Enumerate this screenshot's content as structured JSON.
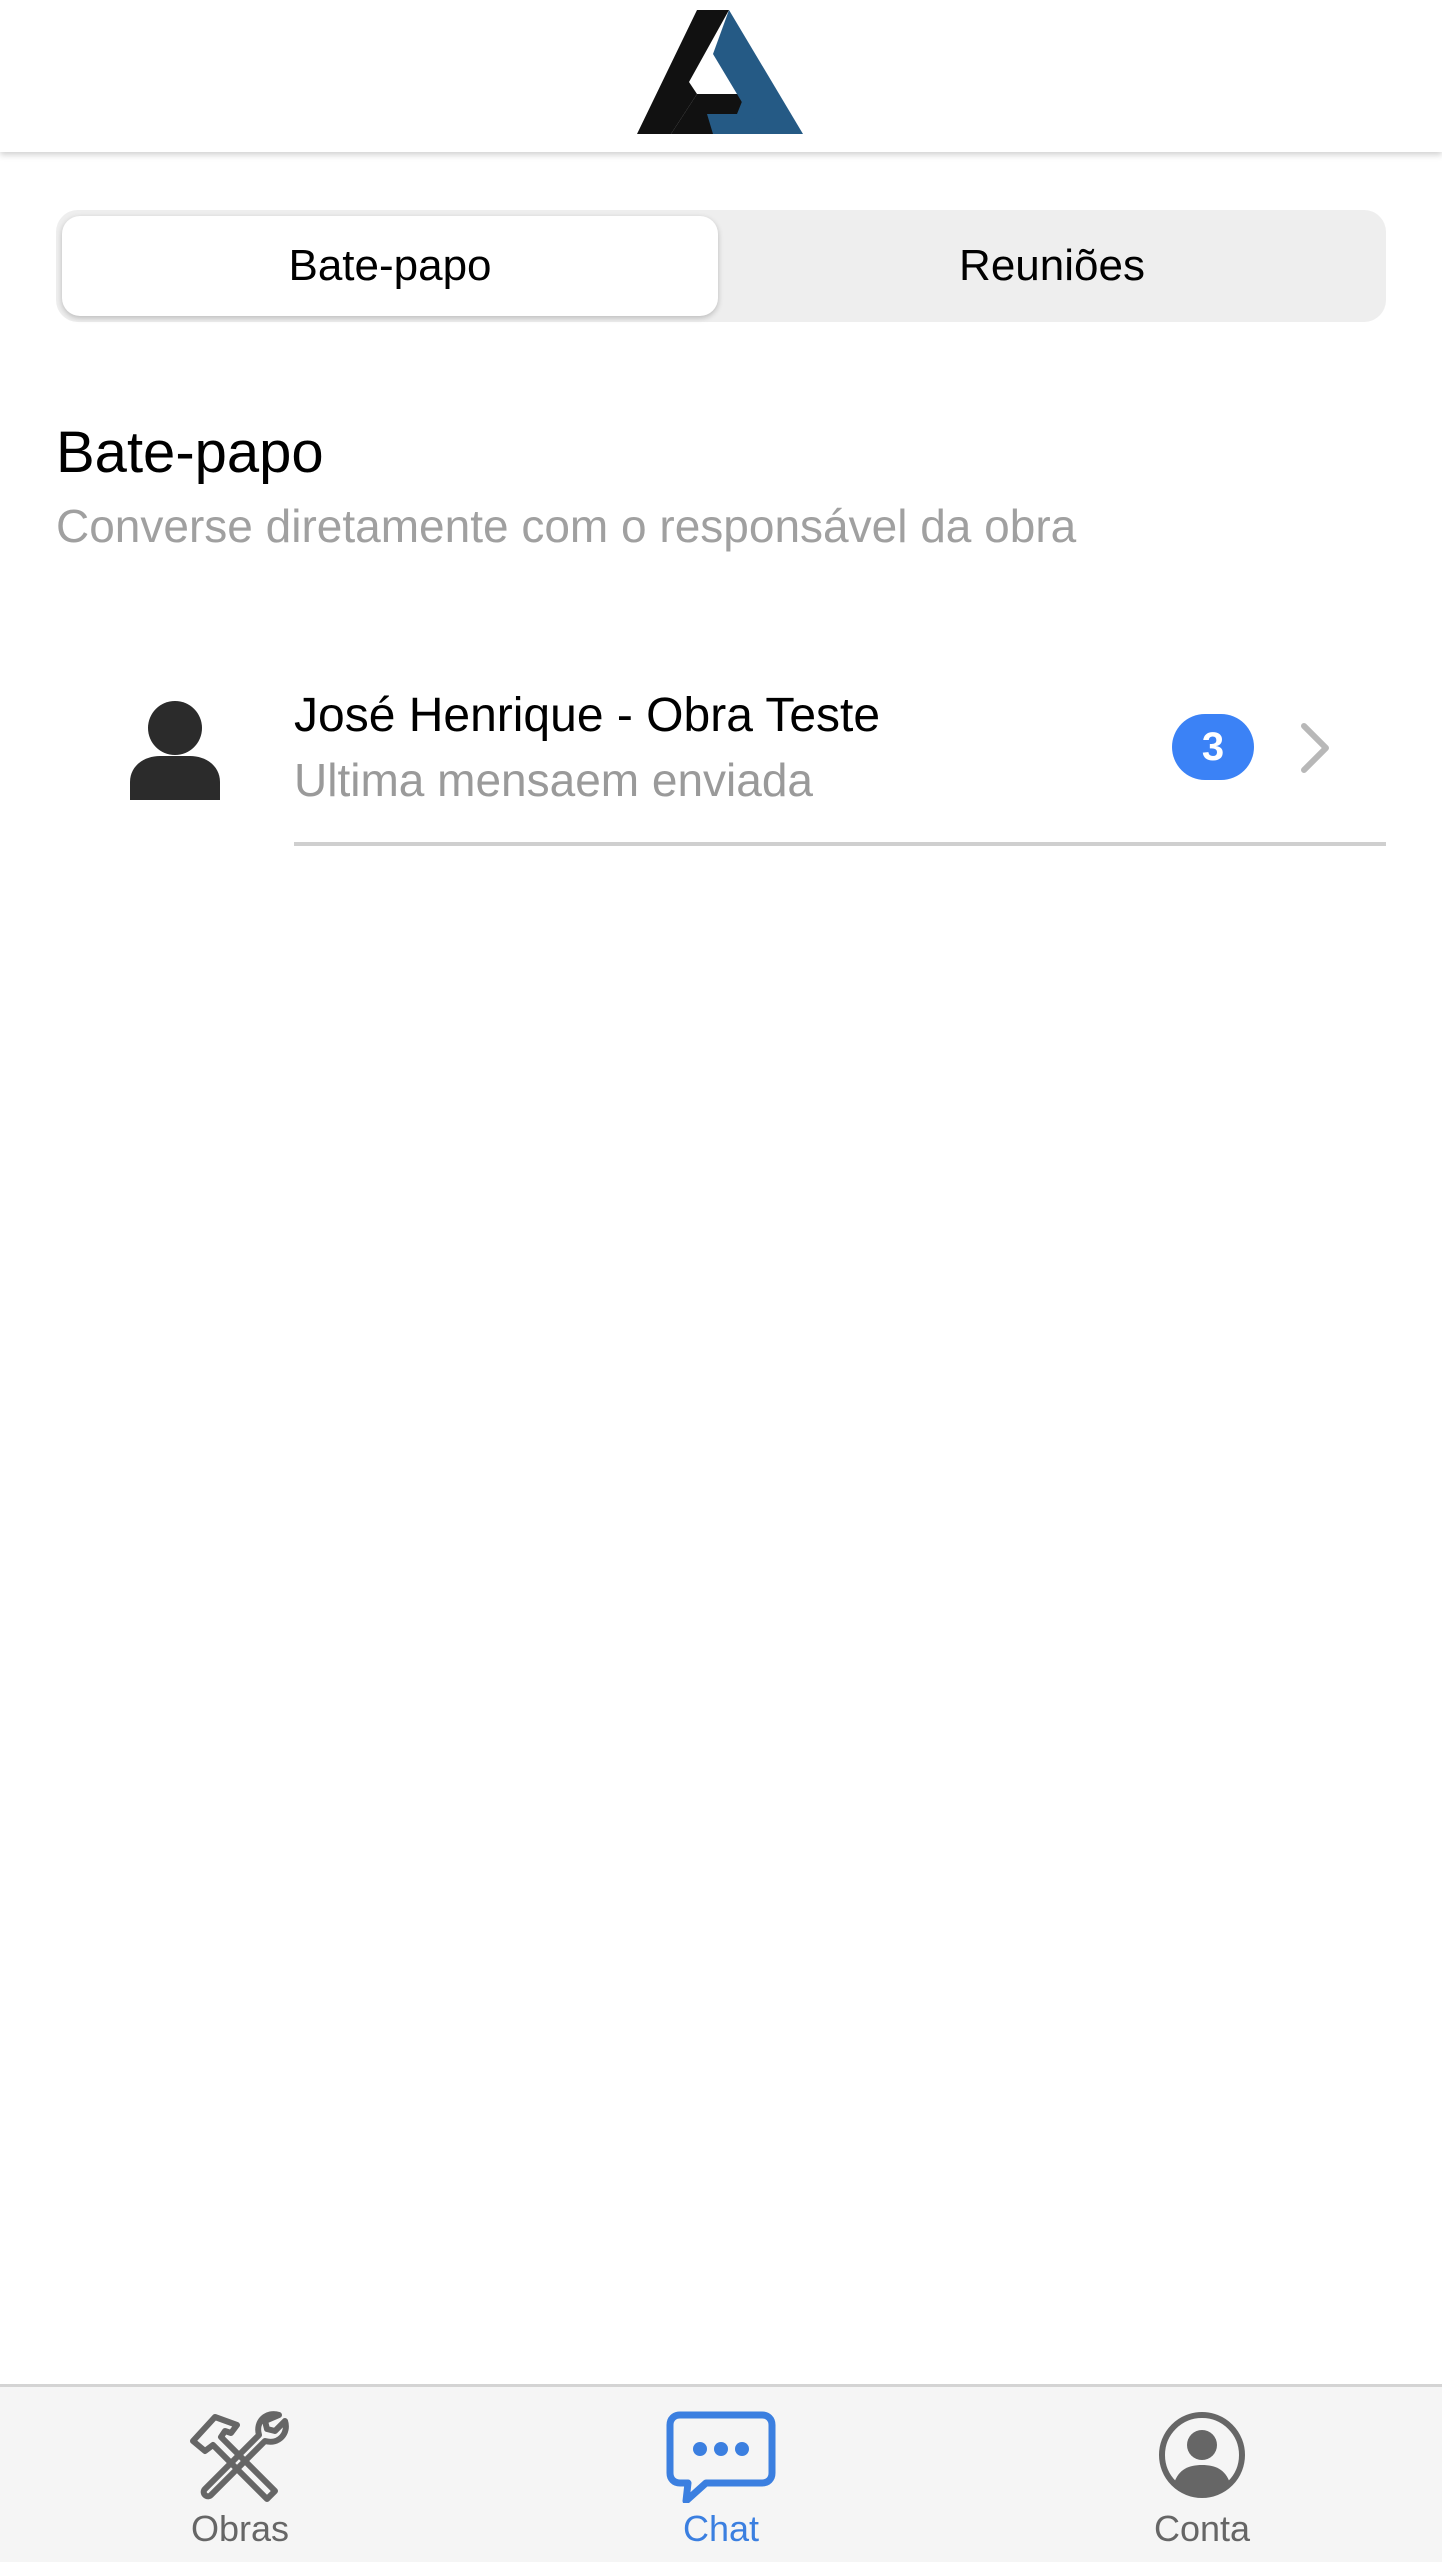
{
  "header": {
    "logo_icon": "brand-logo",
    "colors": {
      "dark": "#111111",
      "accent": "#255a85"
    }
  },
  "segment": {
    "active": "Bate-papo",
    "tabs": [
      {
        "label": "Bate-papo"
      },
      {
        "label": "Reuniões"
      }
    ]
  },
  "section": {
    "title": "Bate-papo",
    "subtitle": "Converse diretamente com o responsável da obra"
  },
  "chats": [
    {
      "name": "José Henrique - Obra Teste",
      "last_message": "Ultima mensaem enviada",
      "unread": "3",
      "avatar_icon": "person-icon",
      "chevron_icon": "chevron-right-icon"
    }
  ],
  "tabbar": {
    "active": "Chat",
    "active_color": "#3b7fe0",
    "items": [
      {
        "label": "Obras",
        "icon": "tools-icon"
      },
      {
        "label": "Chat",
        "icon": "chat-bubble-icon"
      },
      {
        "label": "Conta",
        "icon": "account-circle-icon"
      }
    ]
  }
}
